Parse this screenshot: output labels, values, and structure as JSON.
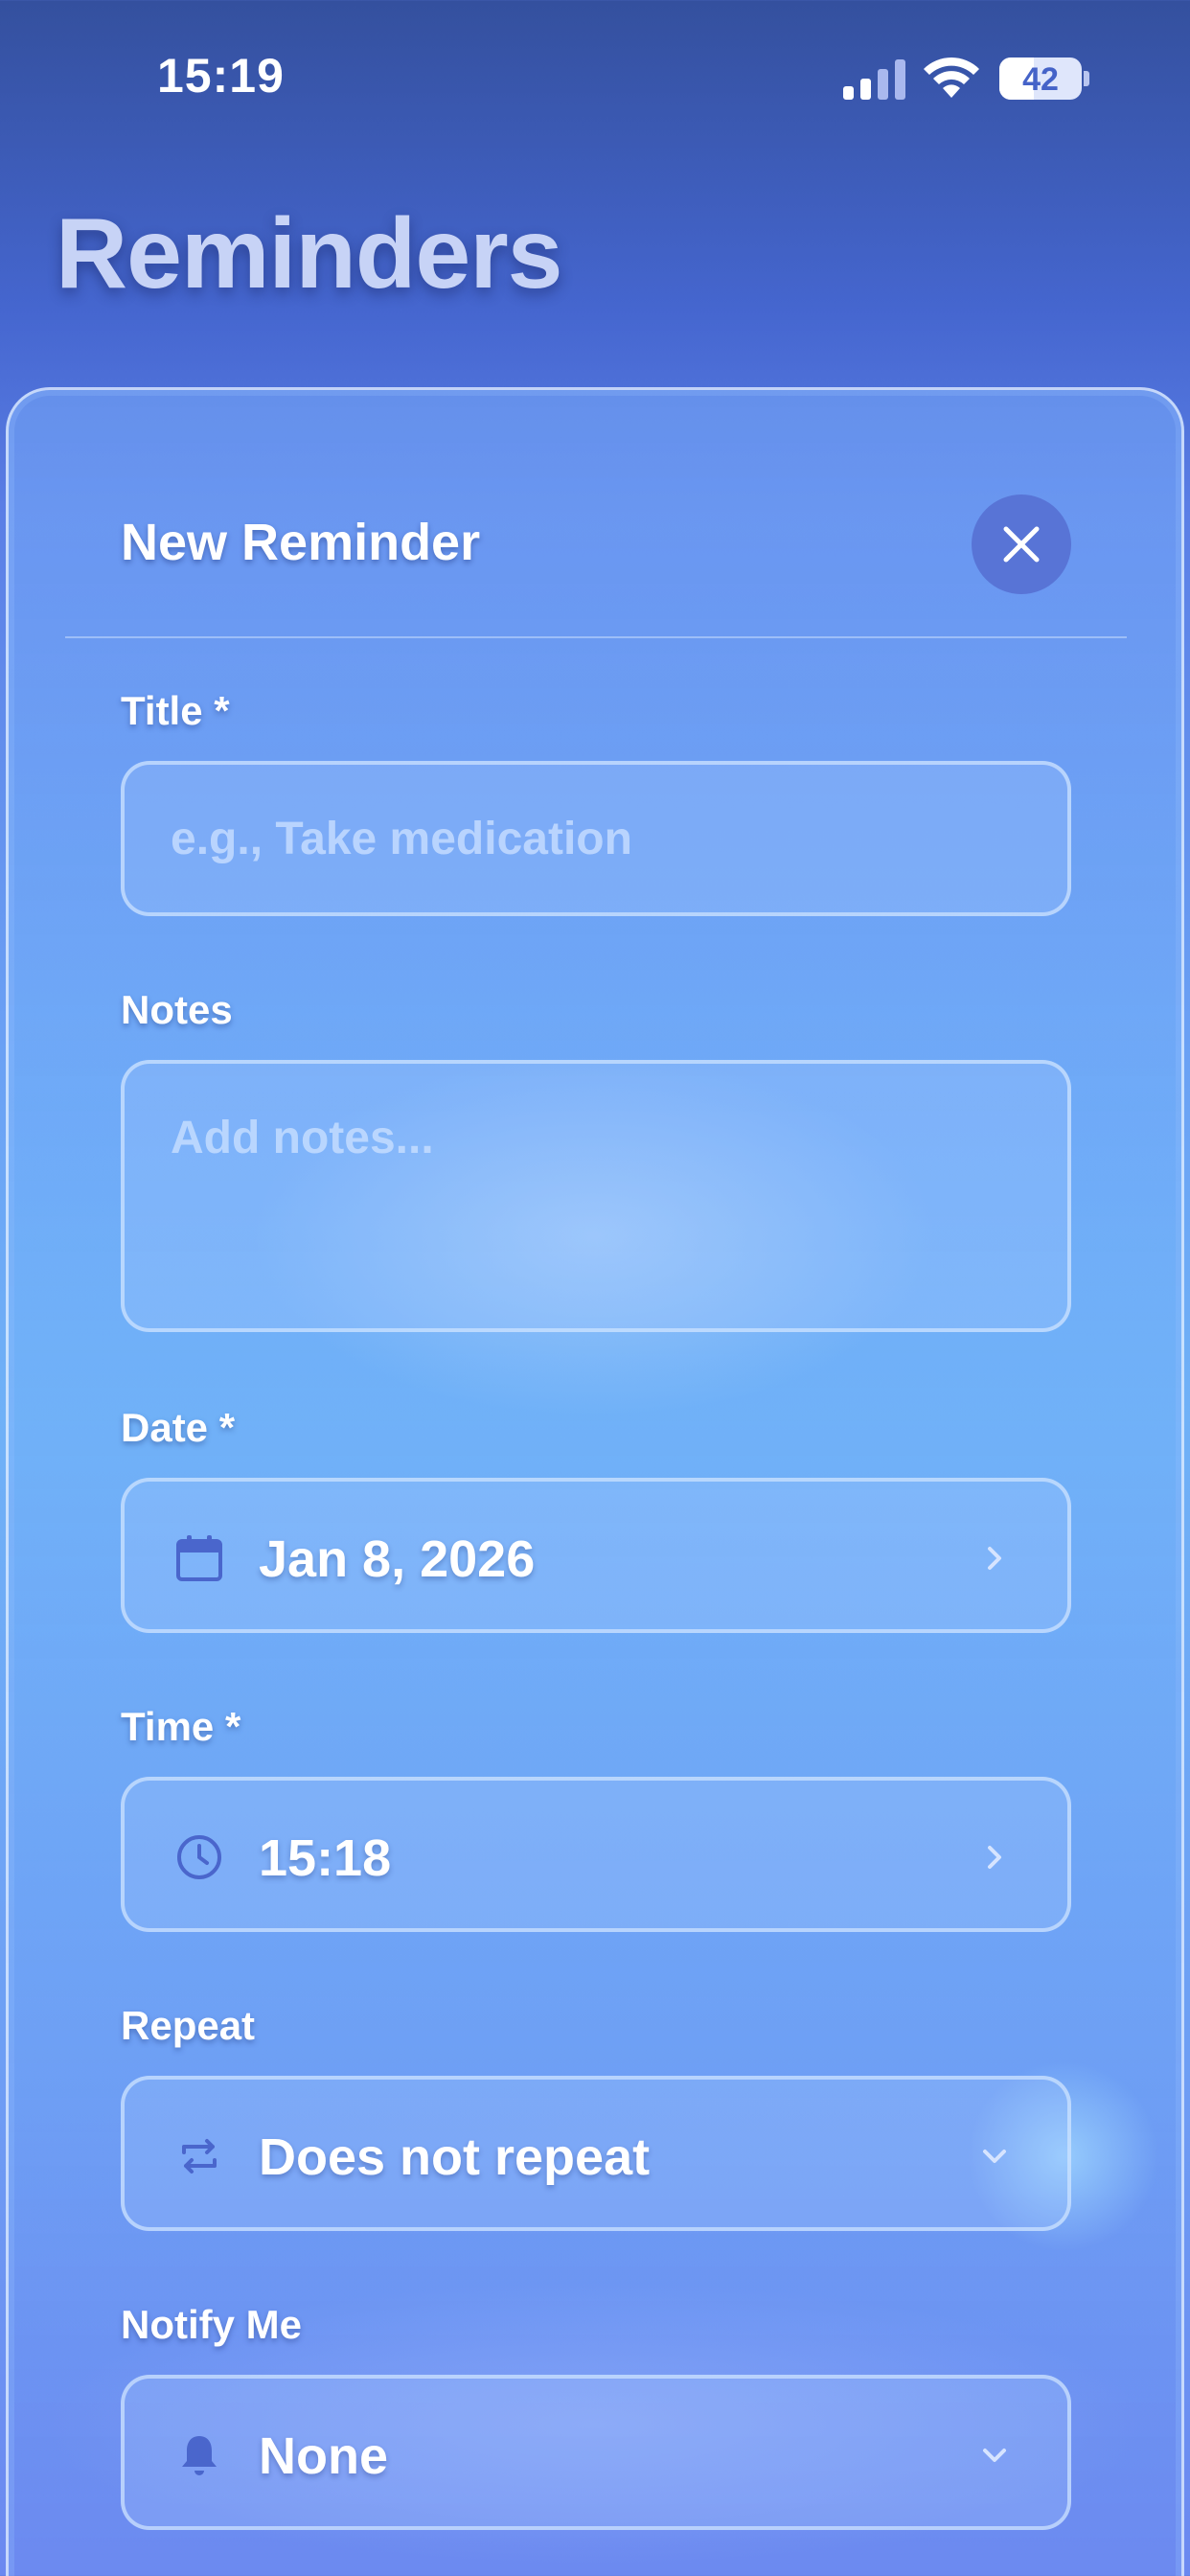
{
  "status_bar": {
    "time": "15:19",
    "battery_level": "42",
    "battery_fraction": 0.42
  },
  "page": {
    "title": "Reminders"
  },
  "sheet": {
    "title": "New Reminder",
    "close_icon": "close-icon"
  },
  "form": {
    "title_label": "Title *",
    "title_placeholder": "e.g., Take medication",
    "notes_label": "Notes",
    "notes_placeholder": "Add notes...",
    "date_label": "Date *",
    "date_value": "Jan 8, 2026",
    "date_icon": "calendar-icon",
    "time_label": "Time *",
    "time_value": "15:18",
    "time_icon": "clock-icon",
    "repeat_label": "Repeat",
    "repeat_value": "Does not repeat",
    "repeat_icon": "repeat-icon",
    "notify_label": "Notify Me",
    "notify_value": "None",
    "notify_icon": "bell-icon"
  },
  "colors": {
    "accent": "#5874d6",
    "icon": "#4a66cc"
  }
}
